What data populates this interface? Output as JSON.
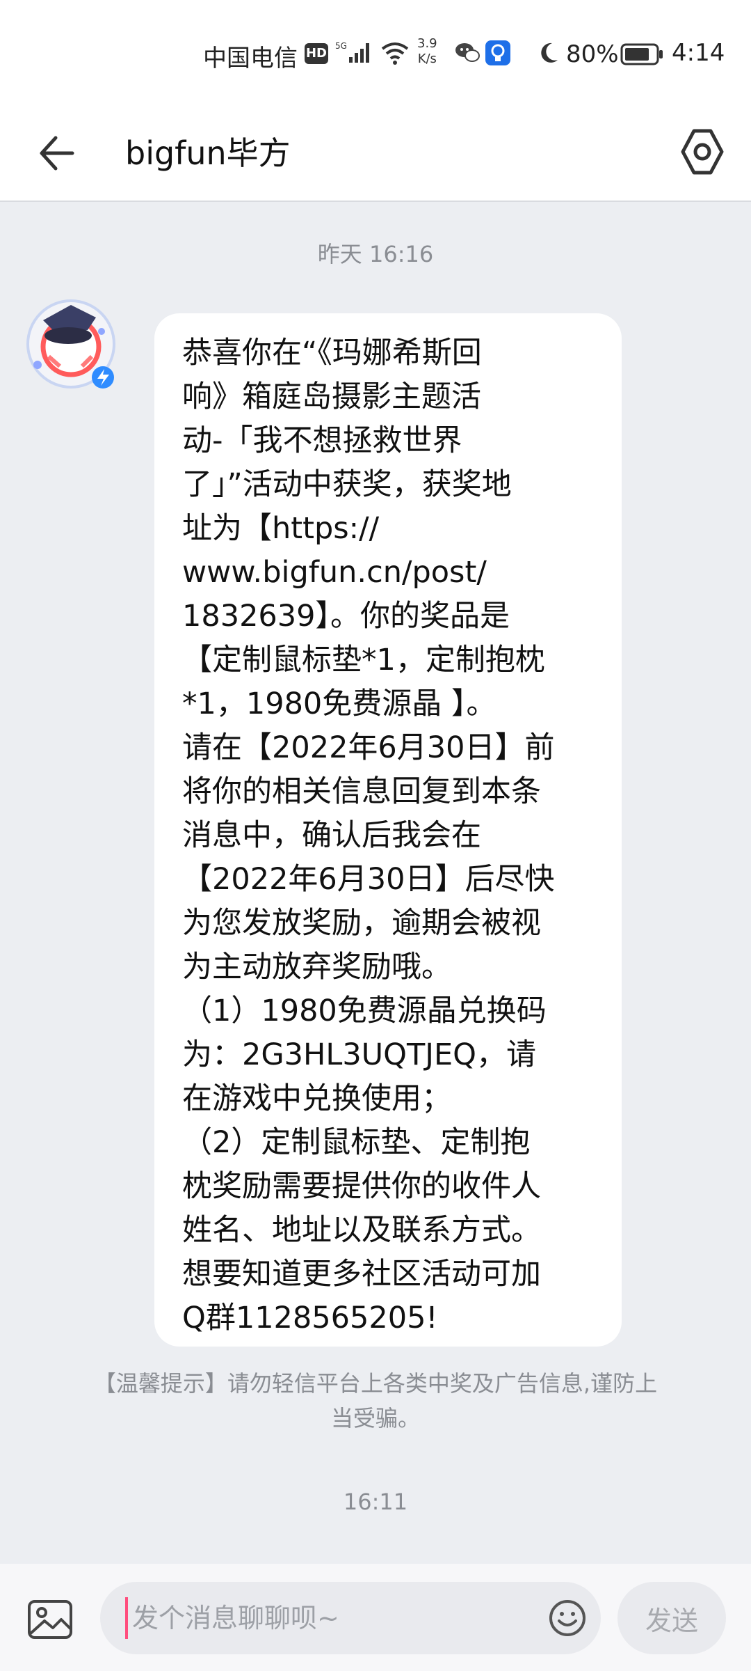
{
  "status_bar": {
    "carrier": "中国电信",
    "hd": "HD",
    "network_type": "5G",
    "speed_value": "3.9",
    "speed_unit": "K/s",
    "battery_percent": "80%",
    "time": "4:14"
  },
  "header": {
    "title": "bigfun毕方"
  },
  "conversation": {
    "timestamp_top": "昨天 16:16",
    "message_lines": [
      "恭喜你在“《玛娜希斯回",
      "响》箱庭岛摄影主题活",
      "动-「我不想拯救世界",
      "了」”活动中获奖，获奖地",
      "址为【https://",
      "www.bigfun.cn/post/",
      "1832639】。你的奖品是",
      "【定制鼠标垫*1，定制抱枕",
      "*1，1980免费源晶 】。",
      "请在【2022年6月30日】前",
      "将你的相关信息回复到本条",
      "消息中，确认后我会在",
      "【2022年6月30日】后尽快",
      "为您发放奖励，逾期会被视",
      "为主动放弃奖励哦。",
      "（1）1980免费源晶兑换码",
      "为：2G3HL3UQTJEQ，请",
      "在游戏中兑换使用；",
      "（2）定制鼠标垫、定制抱",
      "枕奖励需要提供你的收件人",
      "姓名、地址以及联系方式。",
      "想要知道更多社区活动可加",
      "Q群1128565205!"
    ],
    "warning_line1": "【温馨提示】请勿轻信平台上各类中奖及广告信息,谨防上",
    "warning_line2": "当受骗。",
    "timestamp_bottom": "16:11"
  },
  "composer": {
    "placeholder": "发个消息聊聊呗~",
    "send_label": "发送"
  },
  "colors": {
    "background": "#eceef2",
    "bubble": "#ffffff",
    "caret": "#ff4d7d",
    "muted_text": "#8a8d93"
  }
}
